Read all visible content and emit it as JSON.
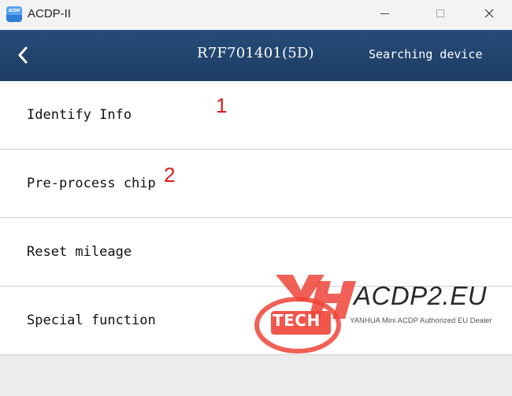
{
  "window": {
    "title": "ACDP-II",
    "app_icon_text": "ACDP",
    "controls": [
      "minimize",
      "maximize",
      "close"
    ]
  },
  "header": {
    "chip_title": "R7F701401(5D)",
    "status": "Searching device",
    "background_color": "#224673"
  },
  "menu": {
    "items": [
      {
        "label": "Identify Info"
      },
      {
        "label": "Pre-process chip"
      },
      {
        "label": "Reset mileage"
      },
      {
        "label": "Special function"
      }
    ]
  },
  "annotations": {
    "step1": "1",
    "step2": "2",
    "color": "#e11a1a"
  },
  "watermark": {
    "logo_text": "TECH",
    "brand": "ACDP2.EU",
    "subtitle": "YANHUA Mini ACDP Authorized EU Dealer",
    "logo_color": "#ef4438"
  }
}
